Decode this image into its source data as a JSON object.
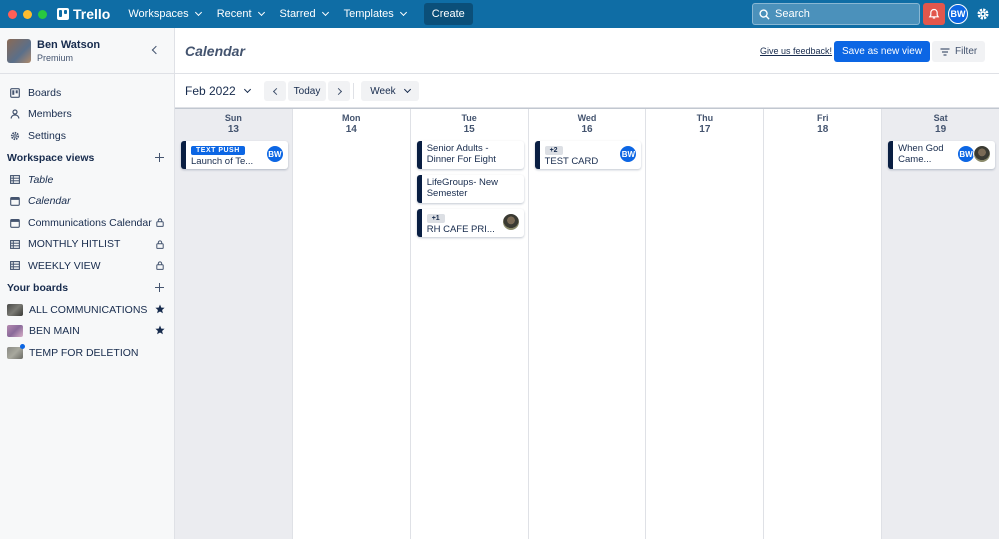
{
  "app": {
    "name": "Trello"
  },
  "topbar": {
    "nav": [
      "Workspaces",
      "Recent",
      "Starred",
      "Templates"
    ],
    "create": "Create",
    "search_placeholder": "Search",
    "avatar": "BW",
    "colors": {
      "bar": "#0f6da5",
      "bell": "#e2574c"
    }
  },
  "sidebar": {
    "user": {
      "name": "Ben Watson",
      "plan": "Premium"
    },
    "primary": [
      {
        "label": "Boards",
        "icon": "board-icon"
      },
      {
        "label": "Members",
        "icon": "person-icon"
      },
      {
        "label": "Settings",
        "icon": "gear-icon"
      }
    ],
    "views_heading": "Workspace views",
    "views": [
      {
        "label": "Table",
        "icon": "table-icon",
        "italic": true,
        "locked": false
      },
      {
        "label": "Calendar",
        "icon": "calendar-icon",
        "italic": true,
        "locked": false
      },
      {
        "label": "Communications Calendar",
        "icon": "calendar-icon",
        "italic": false,
        "locked": true
      },
      {
        "label": "MONTHLY HITLIST",
        "icon": "table-icon",
        "italic": false,
        "locked": true
      },
      {
        "label": "WEEKLY VIEW",
        "icon": "table-icon",
        "italic": false,
        "locked": true
      }
    ],
    "boards_heading": "Your boards",
    "boards": [
      {
        "label": "ALL COMMUNICATIONS",
        "starred": true
      },
      {
        "label": "BEN MAIN",
        "starred": true
      },
      {
        "label": "TEMP FOR DELETION",
        "starred": false
      }
    ]
  },
  "main": {
    "title": "Calendar",
    "feedback": "Give us feedback!",
    "save_view": "Save as new view",
    "filter": "Filter",
    "month": "Feb 2022",
    "today": "Today",
    "range": "Week"
  },
  "days": [
    {
      "dow": "Sun",
      "num": "13",
      "weekend": true,
      "cards": [
        {
          "badge": "TEXT PUSH",
          "badge_style": "blue",
          "title": "Launch of Te...",
          "avatar": "BW"
        }
      ]
    },
    {
      "dow": "Mon",
      "num": "14",
      "weekend": false,
      "cards": []
    },
    {
      "dow": "Tue",
      "num": "15",
      "weekend": false,
      "cards": [
        {
          "title": "Senior Adults - Dinner For Eight"
        },
        {
          "title": "LifeGroups- New Semester"
        },
        {
          "badge": "+1",
          "badge_style": "grey",
          "title": "RH CAFE PRI...",
          "photo": true
        }
      ]
    },
    {
      "dow": "Wed",
      "num": "16",
      "weekend": false,
      "cards": [
        {
          "badge": "+2",
          "badge_style": "grey",
          "title": "TEST CARD",
          "avatar": "BW"
        }
      ]
    },
    {
      "dow": "Thu",
      "num": "17",
      "weekend": false,
      "cards": []
    },
    {
      "dow": "Fri",
      "num": "18",
      "weekend": false,
      "cards": []
    },
    {
      "dow": "Sat",
      "num": "19",
      "weekend": true,
      "cards": [
        {
          "title": "When God Came...",
          "avatar": "BW",
          "photo": true
        }
      ]
    }
  ]
}
